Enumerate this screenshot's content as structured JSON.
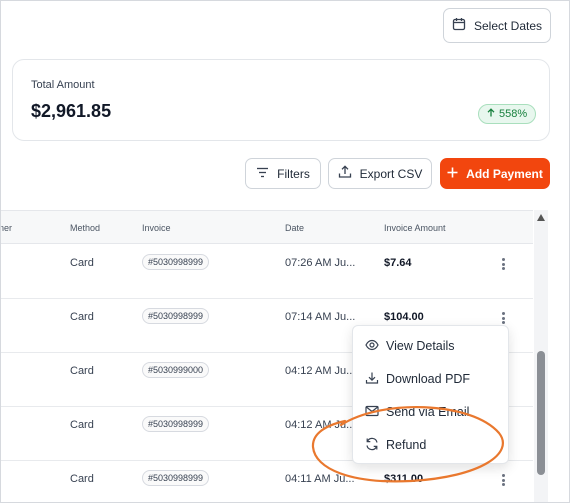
{
  "toolbar": {
    "select_dates": "Select Dates",
    "filters": "Filters",
    "export_csv": "Export CSV",
    "add_payment": "Add Payment"
  },
  "summary": {
    "label": "Total Amount",
    "value": "$2,961.85",
    "change": "558%"
  },
  "table": {
    "columns": [
      "ner",
      "Method",
      "Invoice",
      "Date",
      "Invoice Amount"
    ],
    "rows": [
      {
        "method": "Card",
        "invoice": "#5030998999",
        "date": "07:26 AM Ju...",
        "amount": "$7.64"
      },
      {
        "method": "Card",
        "invoice": "#5030998999",
        "date": "07:14 AM Ju...",
        "amount": "$104.00"
      },
      {
        "method": "Card",
        "invoice": "#5030999000",
        "date": "04:12 AM Ju...",
        "amount": ""
      },
      {
        "method": "Card",
        "invoice": "#5030998999",
        "date": "04:12 AM Ju...",
        "amount": ""
      },
      {
        "method": "Card",
        "invoice": "#5030998999",
        "date": "04:11 AM Ju...",
        "amount": "$311.00"
      }
    ]
  },
  "menu": {
    "items": [
      {
        "label": "View Details",
        "icon": "eye-icon"
      },
      {
        "label": "Download PDF",
        "icon": "download-icon"
      },
      {
        "label": "Send via Email",
        "icon": "mail-icon"
      },
      {
        "label": "Refund",
        "icon": "refresh-icon"
      }
    ]
  },
  "colors": {
    "accent": "#f2460e",
    "highlight_circle": "#e9782e",
    "badge_green": "#17803d"
  }
}
